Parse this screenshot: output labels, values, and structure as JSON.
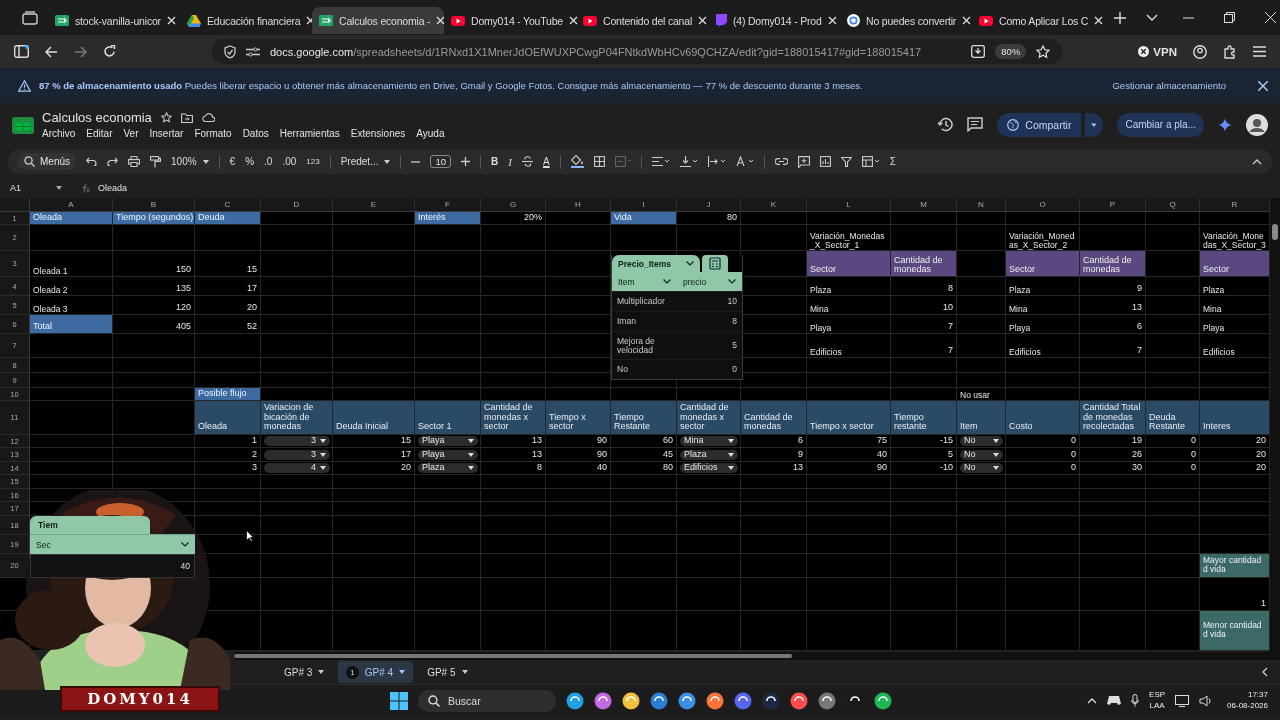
{
  "browser": {
    "tabs": [
      {
        "title": "stock-vanilla-unicor",
        "kind": "sheets",
        "selected": false
      },
      {
        "title": "Educación financiera",
        "kind": "drive",
        "selected": false
      },
      {
        "title": "Calculos economia -",
        "kind": "sheets",
        "selected": true
      },
      {
        "title": "Domy014 - YouTube",
        "kind": "video",
        "selected": false
      },
      {
        "title": "Contenido del canal",
        "kind": "video",
        "selected": false
      },
      {
        "title": "(4) Domy014 - Prod",
        "kind": "stream",
        "selected": false
      },
      {
        "title": "No puedes convertir",
        "kind": "search",
        "selected": false
      },
      {
        "title": "Como Aplicar Los C",
        "kind": "video",
        "selected": false
      }
    ],
    "url_host": "docs.google.com",
    "url_path": "/spreadsheets/d/1RNxd1X1MnerJdOEfWUXPCwgP04FNtkdWbHCv69QCHZA/edit?gid=188015417#gid=188015417",
    "zoom": "80%",
    "vpn": "VPN"
  },
  "banner": {
    "message": "**87 % de almacenamiento usado** Puedes liberar espacio u obtener más almacenamiento en Drive, Gmail y Google Fotos. Consigue más almacenamiento — 77 % de descuento durante 3 meses.",
    "action": "Gestionar almacenamiento"
  },
  "doc": {
    "title": "Calculos economia",
    "menus": [
      "Archivo",
      "Editar",
      "Ver",
      "Insertar",
      "Formato",
      "Datos",
      "Herramientas",
      "Extensiones",
      "Ayuda"
    ],
    "share": "Compartir",
    "switch": "Cambiar a pla..."
  },
  "toolbar": {
    "search_label": "Menús",
    "zoom": "100%",
    "currency": "€",
    "percent": "%",
    "decrease_decimals": ".0",
    "increase_decimals": ".00",
    "number_format": "123",
    "font": "Predet...",
    "font_size": "10",
    "bold": "B",
    "italic": "I",
    "text_color": "A",
    "functions": "Σ"
  },
  "formula_bar": {
    "cell": "A1",
    "value": "Oleada"
  },
  "sheet": {
    "columns": [
      "A",
      "B",
      "C",
      "D",
      "E",
      "F",
      "G",
      "H",
      "I",
      "J",
      "K",
      "L",
      "M",
      "N",
      "O",
      "P",
      "Q",
      "R"
    ],
    "rows": [
      {
        "number": "1",
        "cells": [
          {
            "text": "Oleada",
            "kind": "section"
          },
          {
            "text": "Tiempo (segundos)",
            "kind": "section"
          },
          {
            "text": "Deuda",
            "kind": "section"
          },
          null,
          null,
          {
            "text": "Interés",
            "kind": "section"
          },
          {
            "text": "20%",
            "kind": "number"
          },
          null,
          {
            "text": "Vida",
            "kind": "section"
          },
          {
            "text": "80",
            "kind": "number"
          }
        ]
      },
      {
        "number": "2",
        "cells": [
          null,
          null,
          null,
          null,
          null,
          null,
          null,
          null,
          null,
          null,
          null,
          {
            "text": "Variación_Monedas_X_Sector_1",
            "kind": "label"
          },
          null,
          null,
          {
            "text": "Variación_Monedas_X_Sector_2",
            "kind": "label"
          },
          null,
          null,
          {
            "text": "Variación_Monedas_X_Sector_3",
            "kind": "label"
          }
        ]
      },
      {
        "number": "3",
        "cells": [
          {
            "text": "Oleada 1",
            "kind": "label"
          },
          {
            "text": "150",
            "kind": "number"
          },
          {
            "text": "15",
            "kind": "number"
          },
          null,
          null,
          null,
          null,
          null,
          null,
          null,
          null,
          {
            "text": "Sector",
            "kind": "group"
          },
          {
            "text": "Cantidad de monedas",
            "kind": "group"
          },
          null,
          {
            "text": "Sector",
            "kind": "group"
          },
          {
            "text": "Cantidad de monedas",
            "kind": "group"
          },
          null,
          {
            "text": "Sector",
            "kind": "group"
          }
        ]
      },
      {
        "number": "4",
        "cells": [
          {
            "text": "Oleada 2",
            "kind": "label"
          },
          {
            "text": "135",
            "kind": "number"
          },
          {
            "text": "17",
            "kind": "number"
          },
          null,
          null,
          null,
          null,
          null,
          null,
          null,
          null,
          {
            "text": "Plaza",
            "kind": "label"
          },
          {
            "text": "8",
            "kind": "number"
          },
          null,
          {
            "text": "Plaza",
            "kind": "label"
          },
          {
            "text": "9",
            "kind": "number"
          },
          null,
          {
            "text": "Plaza",
            "kind": "label"
          }
        ]
      },
      {
        "number": "5",
        "cells": [
          {
            "text": "Oleada 3",
            "kind": "label"
          },
          {
            "text": "120",
            "kind": "number"
          },
          {
            "text": "20",
            "kind": "number"
          },
          null,
          null,
          null,
          null,
          null,
          null,
          null,
          null,
          {
            "text": "Mina",
            "kind": "label"
          },
          {
            "text": "10",
            "kind": "number"
          },
          null,
          {
            "text": "Mina",
            "kind": "label"
          },
          {
            "text": "13",
            "kind": "number"
          },
          null,
          {
            "text": "Mina",
            "kind": "label"
          }
        ]
      },
      {
        "number": "6",
        "cells": [
          {
            "text": "Total",
            "kind": "section"
          },
          {
            "text": "405",
            "kind": "number"
          },
          {
            "text": "52",
            "kind": "number"
          },
          null,
          null,
          null,
          null,
          null,
          null,
          null,
          null,
          {
            "text": "Playa",
            "kind": "label"
          },
          {
            "text": "7",
            "kind": "number"
          },
          null,
          {
            "text": "Playa",
            "kind": "label"
          },
          {
            "text": "6",
            "kind": "number"
          },
          null,
          {
            "text": "Playa",
            "kind": "label"
          }
        ]
      },
      {
        "number": "7",
        "cells": [
          null,
          null,
          null,
          null,
          null,
          null,
          null,
          null,
          null,
          null,
          null,
          {
            "text": "Edificios",
            "kind": "label"
          },
          {
            "text": "7",
            "kind": "number"
          },
          null,
          {
            "text": "Edificios",
            "kind": "label"
          },
          {
            "text": "7",
            "kind": "number"
          },
          null,
          {
            "text": "Edificios",
            "kind": "label"
          }
        ]
      },
      {
        "number": "8",
        "cells": []
      },
      {
        "number": "9",
        "cells": []
      },
      {
        "number": "10",
        "cells": [
          null,
          null,
          {
            "text": "Posible flujo",
            "kind": "section"
          },
          null,
          null,
          null,
          null,
          null,
          null,
          null,
          null,
          null,
          null,
          {
            "text": "No usar",
            "kind": "label"
          }
        ]
      },
      {
        "number": "11",
        "cells": [
          null,
          null,
          {
            "text": "Oleada",
            "kind": "column-header"
          },
          {
            "text": "Variacion de bicación de monedas",
            "kind": "column-header"
          },
          {
            "text": "Deuda Inicial",
            "kind": "column-header"
          },
          {
            "text": "Sector 1",
            "kind": "column-header"
          },
          {
            "text": "Cantidad de monedas x sector",
            "kind": "column-header"
          },
          {
            "text": "Tiempo x sector",
            "kind": "column-header"
          },
          {
            "text": "Tiempo Restante",
            "kind": "column-header"
          },
          {
            "text": "Cantidad de monedas x sector",
            "kind": "column-header"
          },
          {
            "text": "Cantidad de monedas",
            "kind": "column-header"
          },
          {
            "text": "Tiempo x sector",
            "kind": "column-header"
          },
          {
            "text": "Tiempo restante",
            "kind": "column-header"
          },
          {
            "text": "Item",
            "kind": "column-header"
          },
          {
            "text": "Costo",
            "kind": "column-header"
          },
          {
            "text": "Cantidad Total de monedas recolectadas",
            "kind": "column-header"
          },
          {
            "text": "Deuda Restante",
            "kind": "column-header"
          },
          {
            "text": "Interes",
            "kind": "column-header"
          }
        ]
      },
      {
        "number": "12",
        "cells": [
          null,
          null,
          {
            "text": "1",
            "kind": "number"
          },
          {
            "text": "3",
            "kind": "dropdown-number"
          },
          {
            "text": "15",
            "kind": "number"
          },
          {
            "text": "Playa",
            "kind": "dropdown-text"
          },
          {
            "text": "13",
            "kind": "number"
          },
          {
            "text": "90",
            "kind": "number"
          },
          {
            "text": "60",
            "kind": "number"
          },
          {
            "text": "Mina",
            "kind": "dropdown-text"
          },
          {
            "text": "6",
            "kind": "number"
          },
          {
            "text": "75",
            "kind": "number"
          },
          {
            "text": "-15",
            "kind": "number"
          },
          {
            "text": "No",
            "kind": "dropdown-text"
          },
          {
            "text": "0",
            "kind": "number"
          },
          {
            "text": "19",
            "kind": "number"
          },
          {
            "text": "0",
            "kind": "number"
          },
          {
            "text": "20",
            "kind": "number"
          }
        ]
      },
      {
        "number": "13",
        "cells": [
          null,
          null,
          {
            "text": "2",
            "kind": "number"
          },
          {
            "text": "3",
            "kind": "dropdown-number"
          },
          {
            "text": "17",
            "kind": "number"
          },
          {
            "text": "Playa",
            "kind": "dropdown-text"
          },
          {
            "text": "13",
            "kind": "number"
          },
          {
            "text": "90",
            "kind": "number"
          },
          {
            "text": "45",
            "kind": "number"
          },
          {
            "text": "Plaza",
            "kind": "dropdown-text"
          },
          {
            "text": "9",
            "kind": "number"
          },
          {
            "text": "40",
            "kind": "number"
          },
          {
            "text": "5",
            "kind": "number"
          },
          {
            "text": "No",
            "kind": "dropdown-text"
          },
          {
            "text": "0",
            "kind": "number"
          },
          {
            "text": "26",
            "kind": "number"
          },
          {
            "text": "0",
            "kind": "number"
          },
          {
            "text": "20",
            "kind": "number"
          }
        ]
      },
      {
        "number": "14",
        "cells": [
          null,
          null,
          {
            "text": "3",
            "kind": "number"
          },
          {
            "text": "4",
            "kind": "dropdown-number"
          },
          {
            "text": "20",
            "kind": "number"
          },
          {
            "text": "Plaza",
            "kind": "dropdown-text"
          },
          {
            "text": "8",
            "kind": "number"
          },
          {
            "text": "40",
            "kind": "number"
          },
          {
            "text": "80",
            "kind": "number"
          },
          {
            "text": "Edificios",
            "kind": "dropdown-text"
          },
          {
            "text": "13",
            "kind": "number"
          },
          {
            "text": "90",
            "kind": "number"
          },
          {
            "text": "-10",
            "kind": "number"
          },
          {
            "text": "No",
            "kind": "dropdown-text"
          },
          {
            "text": "0",
            "kind": "number"
          },
          {
            "text": "30",
            "kind": "number"
          },
          {
            "text": "0",
            "kind": "number"
          },
          {
            "text": "20",
            "kind": "number"
          }
        ]
      },
      {
        "number": "15",
        "cells": []
      },
      {
        "number": "16",
        "cells": []
      },
      {
        "number": "17",
        "cells": []
      },
      {
        "number": "18",
        "cells": []
      },
      {
        "number": "19",
        "cells": []
      },
      {
        "number": "20",
        "cells": [
          null,
          null,
          null,
          null,
          null,
          null,
          null,
          null,
          null,
          null,
          null,
          null,
          null,
          null,
          null,
          null,
          null,
          {
            "text": "Mayor cantidad d vida",
            "kind": "note"
          }
        ]
      },
      {
        "cells": [
          null,
          null,
          null,
          null,
          null,
          null,
          null,
          null,
          null,
          null,
          null,
          null,
          null,
          null,
          null,
          null,
          null,
          {
            "text": "1",
            "kind": "number"
          }
        ]
      },
      {
        "cells": [
          null,
          null,
          null,
          null,
          null,
          null,
          null,
          null,
          null,
          null,
          null,
          null,
          null,
          null,
          null,
          null,
          null,
          {
            "text": "Menor cantidad d vida",
            "kind": "note"
          }
        ]
      }
    ],
    "price_table": {
      "name": "Precio_Items",
      "columns": [
        "Item",
        "precio"
      ],
      "rows": [
        [
          "Multiplicador",
          "10"
        ],
        [
          "Iman",
          "8"
        ],
        [
          "Mejora de velocidad",
          "5"
        ],
        [
          "No",
          "0"
        ]
      ]
    },
    "hidden_table": {
      "header": "Tiem",
      "column": "Sec",
      "value": "40"
    }
  },
  "sheet_tabs": [
    {
      "label": "GP# 3",
      "selected": false
    },
    {
      "label": "GP# 4",
      "badge": "1",
      "selected": true
    },
    {
      "label": "GP# 5",
      "selected": false
    }
  ],
  "stream_overlay": {
    "kind": "picture",
    "logo": "DOMY014"
  },
  "taskbar": {
    "search": "Buscar",
    "language": "ESP",
    "layout": "LAA",
    "time": "17:37",
    "date": "06-08-2026"
  }
}
